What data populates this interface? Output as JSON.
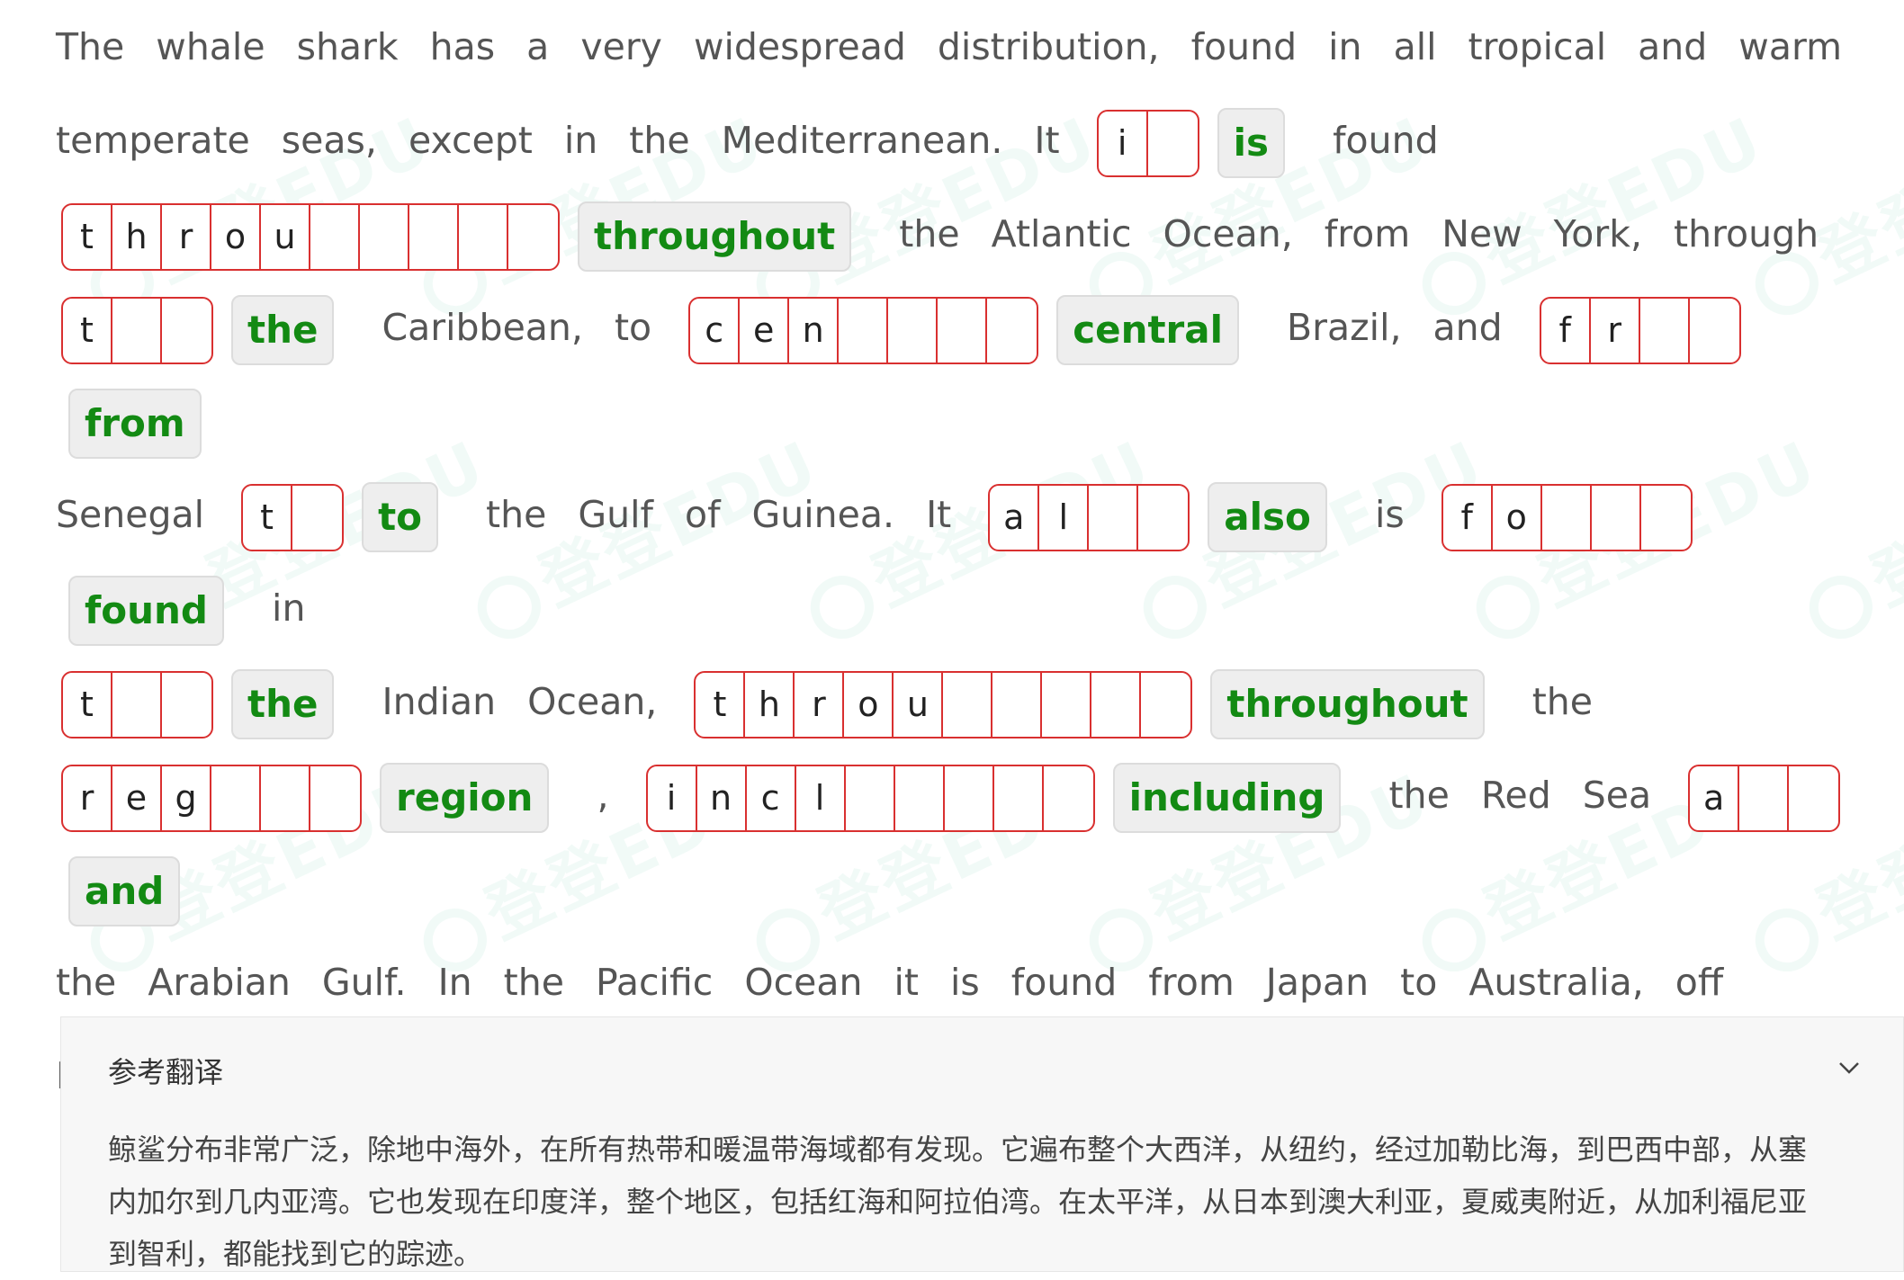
{
  "watermark": {
    "text": "登登EDU"
  },
  "passage": {
    "segments": [
      {
        "t": "text",
        "v": "The whale shark has a very widespread distribution, found in all tropical and warm temperate seas, except in the Mediterranean. It"
      },
      {
        "t": "blank",
        "letters": [
          "i",
          ""
        ],
        "answer": "is"
      },
      {
        "t": "text",
        "v": "found"
      },
      {
        "t": "break"
      },
      {
        "t": "blank",
        "letters": [
          "t",
          "h",
          "r",
          "o",
          "u",
          "",
          "",
          "",
          "",
          ""
        ],
        "answer": "throughout"
      },
      {
        "t": "text",
        "v": "the Atlantic Ocean, from New York, through"
      },
      {
        "t": "break"
      },
      {
        "t": "blank",
        "letters": [
          "t",
          "",
          ""
        ],
        "answer": "the"
      },
      {
        "t": "text",
        "v": "Caribbean, to"
      },
      {
        "t": "blank",
        "letters": [
          "c",
          "e",
          "n",
          "",
          "",
          "",
          ""
        ],
        "answer": "central"
      },
      {
        "t": "text",
        "v": "Brazil, and"
      },
      {
        "t": "blank",
        "letters": [
          "f",
          "r",
          "",
          ""
        ],
        "answer": "from"
      },
      {
        "t": "break"
      },
      {
        "t": "text",
        "v": "Senegal"
      },
      {
        "t": "blank",
        "letters": [
          "t",
          ""
        ],
        "answer": "to"
      },
      {
        "t": "text",
        "v": "the Gulf of Guinea. It"
      },
      {
        "t": "blank",
        "letters": [
          "a",
          "l",
          "",
          ""
        ],
        "answer": "also"
      },
      {
        "t": "text",
        "v": "is"
      },
      {
        "t": "blank",
        "letters": [
          "f",
          "o",
          "",
          "",
          ""
        ],
        "answer": "found"
      },
      {
        "t": "text",
        "v": "in"
      },
      {
        "t": "break"
      },
      {
        "t": "blank",
        "letters": [
          "t",
          "",
          ""
        ],
        "answer": "the"
      },
      {
        "t": "text",
        "v": "Indian Ocean,"
      },
      {
        "t": "blank",
        "letters": [
          "t",
          "h",
          "r",
          "o",
          "u",
          "",
          "",
          "",
          "",
          ""
        ],
        "answer": "throughout"
      },
      {
        "t": "text",
        "v": "the"
      },
      {
        "t": "break"
      },
      {
        "t": "blank",
        "letters": [
          "r",
          "e",
          "g",
          "",
          "",
          ""
        ],
        "answer": "region"
      },
      {
        "t": "text",
        "v": ","
      },
      {
        "t": "blank",
        "letters": [
          "i",
          "n",
          "c",
          "l",
          "",
          "",
          "",
          "",
          ""
        ],
        "answer": "including"
      },
      {
        "t": "text",
        "v": "the Red Sea"
      },
      {
        "t": "blank",
        "letters": [
          "a",
          "",
          ""
        ],
        "answer": "and"
      },
      {
        "t": "break"
      },
      {
        "t": "text",
        "v": "the Arabian Gulf. In the Pacific Ocean it is found from Japan to Australia, off Hawaii, and from California to Chile."
      }
    ]
  },
  "translation": {
    "title": "参考翻译",
    "text": "鲸鲨分布非常广泛，除地中海外，在所有热带和暖温带海域都有发现。它遍布整个大西洋，从纽约，经过加勒比海，到巴西中部，从塞内加尔到几内亚湾。它也发现在印度洋，整个地区，包括红海和阿拉伯湾。在太平洋，从日本到澳大利亚，夏威夷附近，从加利福尼亚到智利，都能找到它的踪迹。",
    "toggle_icon": "chevron-down-icon"
  },
  "colors": {
    "answer_text": "#138a13",
    "blank_border": "#d93030",
    "panel_bg": "#f7f7f7"
  }
}
